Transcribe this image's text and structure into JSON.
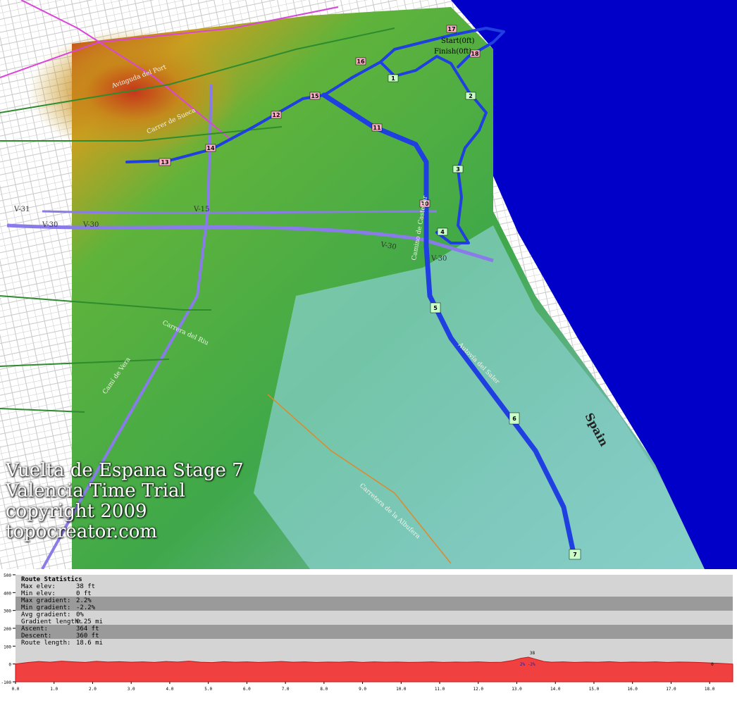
{
  "map": {
    "caption_lines": [
      "Vuelta de Espana Stage 7",
      "Valencia Time Trial",
      "copyright 2009",
      "topocreator.com"
    ],
    "start_label": "Start(0ft)",
    "finish_label": "Finish(0ft)",
    "country_label": "Spain",
    "road_labels": [
      "V-30",
      "V-30",
      "V-30",
      "V-31",
      "V-15",
      "V-30"
    ],
    "street_labels": [
      "Avinguda del Port",
      "Carrer de Sueca",
      "Autovía del Saler",
      "Carretera de la Albufera",
      "Carrera del Riu",
      "Camí de Vera",
      "Camino de Castellar"
    ],
    "km_markers": [
      {
        "label": "1",
        "kind": "green"
      },
      {
        "label": "2",
        "kind": "green"
      },
      {
        "label": "3",
        "kind": "green"
      },
      {
        "label": "4",
        "kind": "green"
      },
      {
        "label": "5",
        "kind": "green"
      },
      {
        "label": "6",
        "kind": "green"
      },
      {
        "label": "7",
        "kind": "green"
      },
      {
        "label": "10",
        "kind": "pink"
      },
      {
        "label": "11",
        "kind": "pink"
      },
      {
        "label": "12",
        "kind": "pink"
      },
      {
        "label": "13",
        "kind": "pink"
      },
      {
        "label": "14",
        "kind": "pink"
      },
      {
        "label": "15",
        "kind": "pink"
      },
      {
        "label": "16",
        "kind": "pink"
      },
      {
        "label": "17",
        "kind": "pink"
      },
      {
        "label": "18",
        "kind": "pink"
      }
    ],
    "colors": {
      "sea": "#0000c8",
      "route": "#1f3fe0",
      "shallow": "#86cfc8",
      "green": "#3fae3f",
      "red": "#c62a1a"
    }
  },
  "profile": {
    "stats_title": "Route Statistics",
    "stats": [
      {
        "key": "Max elev:",
        "value": "38 ft"
      },
      {
        "key": "Min elev:",
        "value": "0 ft"
      },
      {
        "key": "Max gradient:",
        "value": "2.2%"
      },
      {
        "key": "Min gradient:",
        "value": "-2.2%"
      },
      {
        "key": "Avg gradient:",
        "value": "0%"
      },
      {
        "key": "Gradient length:",
        "value": "0.25 mi"
      },
      {
        "key": "Ascent:",
        "value": "364 ft"
      },
      {
        "key": "Descent:",
        "value": "360 ft"
      },
      {
        "key": "Route length:",
        "value": "18.6 mi"
      }
    ],
    "peak_label": "38",
    "gradient_label": "2% -2%",
    "end_marker": "0"
  },
  "chart_data": {
    "type": "area",
    "xlabel": "",
    "ylabel": "",
    "xlim": [
      0,
      18.6
    ],
    "ylim": [
      -100,
      500
    ],
    "x_ticks": [
      "0.0",
      "1.0",
      "2.0",
      "3.0",
      "4.0",
      "5.0",
      "6.0",
      "7.0",
      "8.0",
      "9.0",
      "10.0",
      "11.0",
      "12.0",
      "13.0",
      "14.0",
      "15.0",
      "16.0",
      "17.0",
      "18.0"
    ],
    "y_ticks": [
      "500",
      "400",
      "300",
      "200",
      "100",
      "0",
      "-100"
    ],
    "series": [
      {
        "x": [
          0,
          0.3,
          0.6,
          0.9,
          1.2,
          1.5,
          1.8,
          2.1,
          2.4,
          2.7,
          3.0,
          3.3,
          3.6,
          3.9,
          4.2,
          4.5,
          4.8,
          5.1,
          5.4,
          5.7,
          6.0,
          6.3,
          6.6,
          6.9,
          7.2,
          7.5,
          7.8,
          8.1,
          8.4,
          8.7,
          9.0,
          9.3,
          9.6,
          9.9,
          10.2,
          10.5,
          10.8,
          11.1,
          11.4,
          11.7,
          12.0,
          12.3,
          12.6,
          12.9,
          13.1,
          13.3,
          13.5,
          13.7,
          13.9,
          14.2,
          14.5,
          14.8,
          15.1,
          15.4,
          15.7,
          16.0,
          16.3,
          16.6,
          16.9,
          17.2,
          17.5,
          17.8,
          18.0,
          18.3,
          18.6
        ],
        "values": [
          0,
          8,
          14,
          10,
          16,
          12,
          9,
          15,
          11,
          13,
          10,
          12,
          9,
          14,
          11,
          16,
          10,
          8,
          13,
          10,
          12,
          9,
          11,
          14,
          10,
          12,
          9,
          11,
          10,
          13,
          9,
          12,
          10,
          11,
          9,
          10,
          12,
          9,
          11,
          10,
          12,
          9,
          10,
          20,
          32,
          38,
          26,
          14,
          10,
          12,
          9,
          11,
          10,
          13,
          9,
          11,
          10,
          12,
          9,
          11,
          10,
          8,
          6,
          3,
          0
        ]
      }
    ]
  }
}
